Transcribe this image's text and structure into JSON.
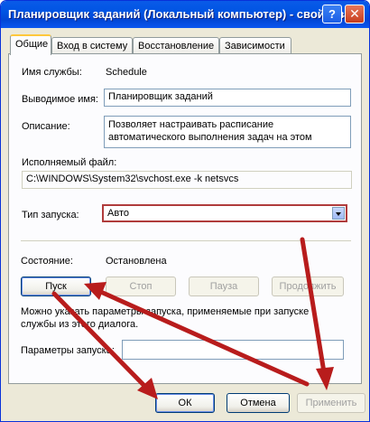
{
  "window": {
    "title": "Планировщик заданий (Локальный компьютер) - свойства",
    "help_label": "?",
    "close_label": "✕"
  },
  "tabs": [
    {
      "label": "Общие",
      "active": true
    },
    {
      "label": "Вход в систему"
    },
    {
      "label": "Восстановление"
    },
    {
      "label": "Зависимости"
    }
  ],
  "general": {
    "service_name_label": "Имя службы:",
    "service_name_value": "Schedule",
    "display_name_label": "Выводимое имя:",
    "display_name_value": "Планировщик заданий",
    "description_label": "Описание:",
    "description_line1": "Позволяет настраивать расписание",
    "description_line2": "автоматического выполнения задач на этом",
    "executable_label": "Исполняемый файл:",
    "executable_value": "C:\\WINDOWS\\System32\\svchost.exe -k netsvcs",
    "startup_type_label": "Тип запуска:",
    "startup_type_value": "Авто",
    "status_label": "Состояние:",
    "status_value": "Остановлена",
    "start_button": "Пуск",
    "stop_button": "Стоп",
    "pause_button": "Пауза",
    "resume_button": "Продолжить",
    "hint_line1": "Можно указать параметры запуска, применяемые при запуске",
    "hint_line2": "службы из этого диалога.",
    "params_label": "Параметры запуска:",
    "params_value": ""
  },
  "footer": {
    "ok_button": "ОК",
    "cancel_button": "Отмена",
    "apply_button": "Применить"
  },
  "colors": {
    "arrow": "#b81c1c",
    "title_bar": "#0054e3",
    "highlight_border": "#b03c3c"
  }
}
